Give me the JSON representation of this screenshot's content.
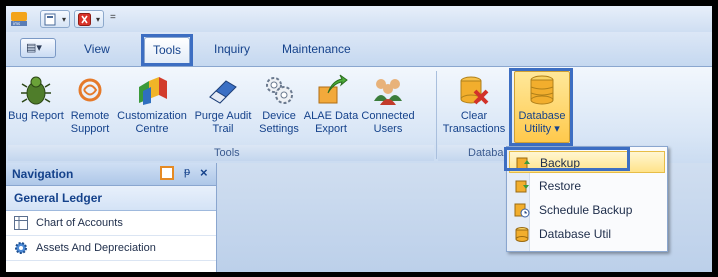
{
  "quick_access": {
    "icons": [
      "app-logo-icon",
      "document-icon",
      "close-red-icon"
    ],
    "separator_glyph": "="
  },
  "tabs": [
    {
      "label": "View",
      "active": false
    },
    {
      "label": "Tools",
      "active": true
    },
    {
      "label": "Inquiry",
      "active": false
    },
    {
      "label": "Maintenance",
      "active": false
    }
  ],
  "ribbon": {
    "groups": [
      {
        "label": "Tools",
        "buttons": [
          {
            "line1": "Bug Report",
            "line2": "",
            "icon": "bug-icon"
          },
          {
            "line1": "Remote",
            "line2": "Support",
            "icon": "remote-support-icon"
          },
          {
            "line1": "Customization",
            "line2": "Centre",
            "icon": "customization-blocks-icon"
          },
          {
            "line1": "Purge Audit",
            "line2": "Trail",
            "icon": "eraser-icon"
          },
          {
            "line1": "Device",
            "line2": "Settings",
            "icon": "gears-icon"
          },
          {
            "line1": "ALAE Data",
            "line2": "Export",
            "icon": "export-arrow-icon"
          },
          {
            "line1": "Connected",
            "line2": "Users",
            "icon": "users-group-icon"
          }
        ]
      },
      {
        "label": "Databa",
        "buttons": [
          {
            "line1": "Clear",
            "line2": "Transactions",
            "icon": "clear-database-icon"
          },
          {
            "line1": "Database",
            "line2": "Utility",
            "icon": "database-icon",
            "dropdown_glyph": "▾"
          }
        ]
      }
    ]
  },
  "database_menu": {
    "items": [
      {
        "label": "Backup",
        "icon": "backup-icon",
        "highlighted": true
      },
      {
        "label": "Restore",
        "icon": "restore-icon",
        "highlighted": false
      },
      {
        "label": "Schedule Backup",
        "icon": "schedule-backup-icon",
        "highlighted": false
      },
      {
        "label": "Database Util",
        "icon": "database-util-icon",
        "highlighted": false
      }
    ]
  },
  "navigation": {
    "title": "Navigation",
    "pin_glyph": "ᵽ",
    "close_glyph": "×",
    "group": "General Ledger",
    "items": [
      {
        "label": "Chart of Accounts",
        "icon": "table-icon"
      },
      {
        "label": "Assets And Depreciation",
        "icon": "gear-blue-icon"
      }
    ]
  },
  "colors": {
    "highlight_border": "#3d6ec2",
    "menu_hover": "#ffe38a",
    "ribbon_text": "#15428b"
  }
}
